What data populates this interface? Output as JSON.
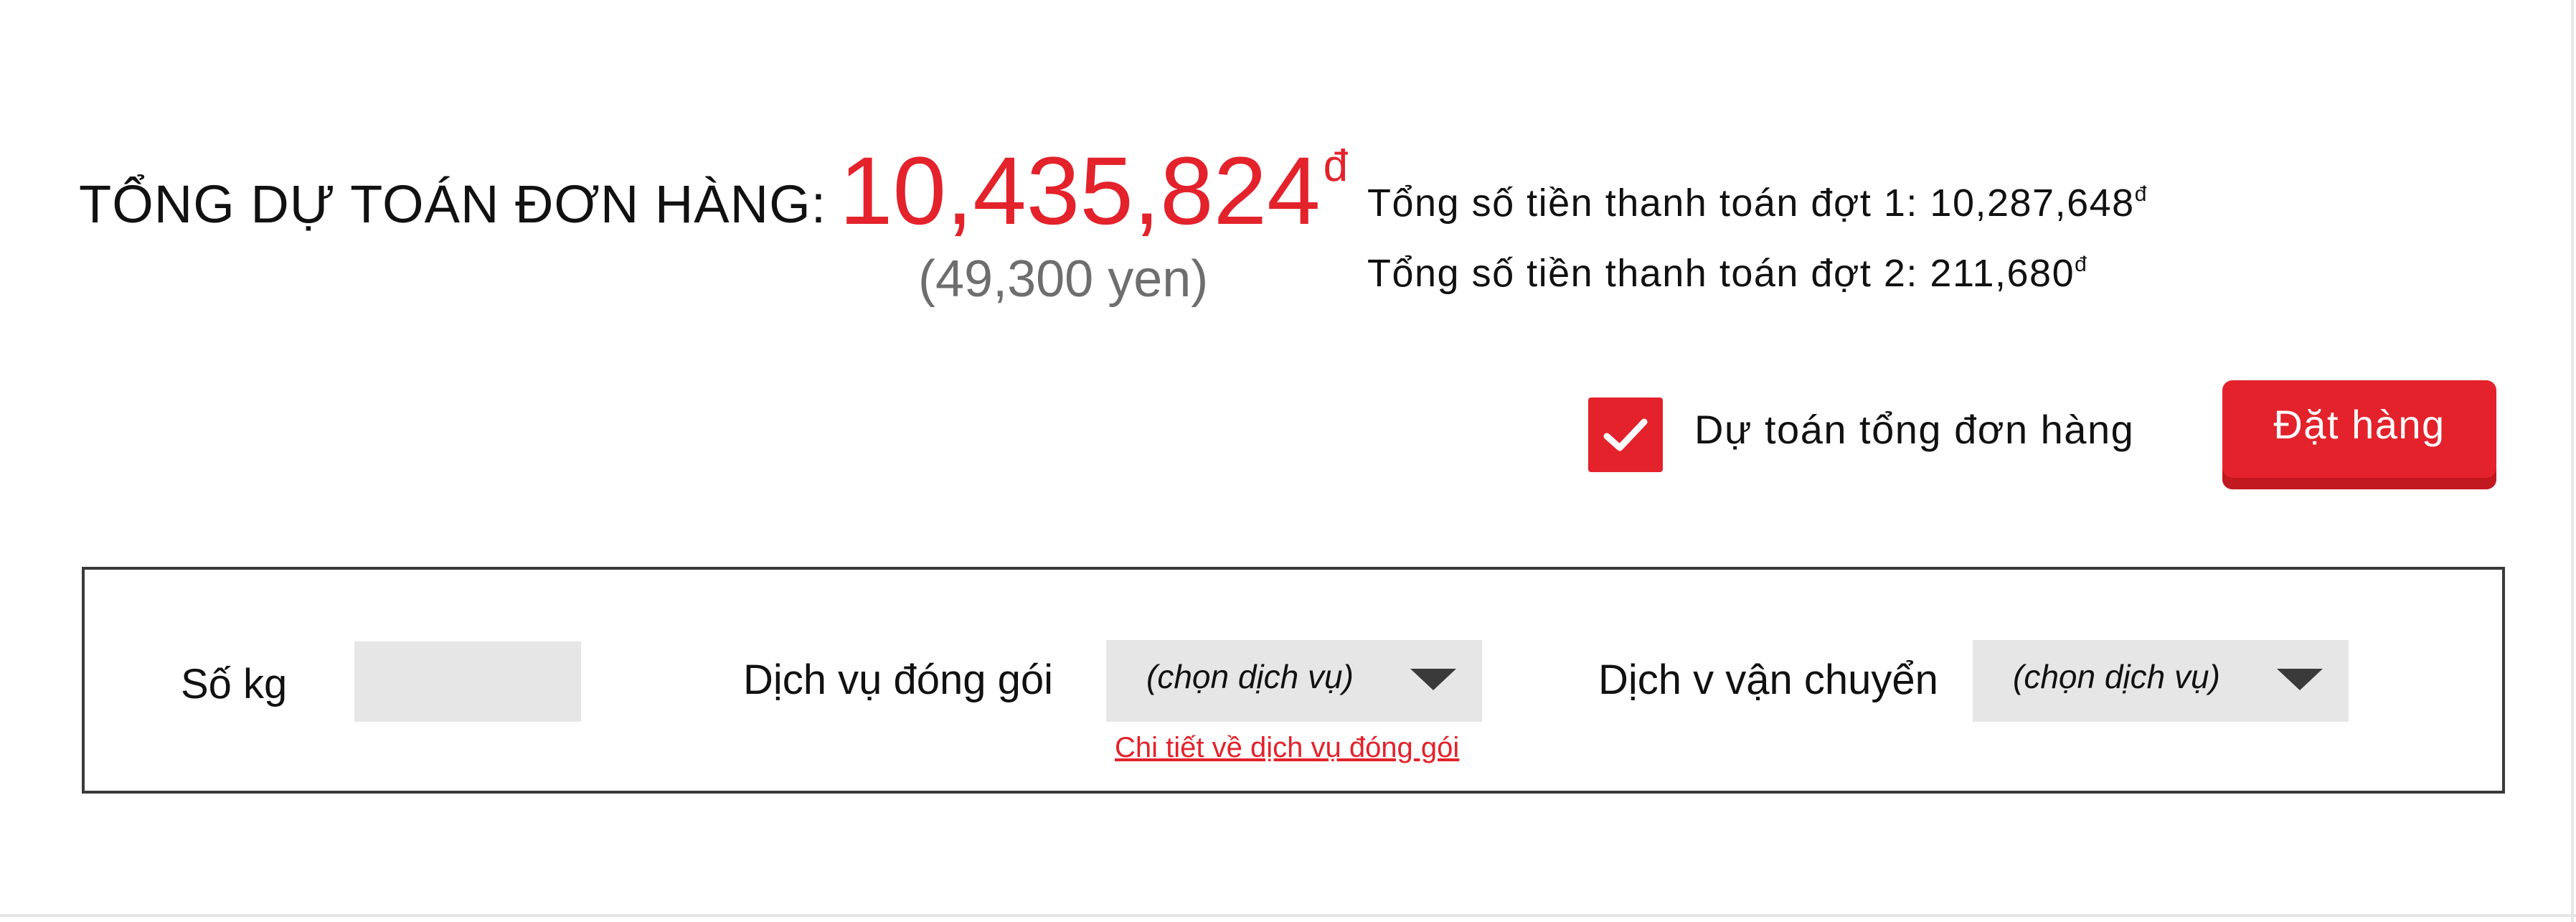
{
  "summary": {
    "title": "TỔNG DỰ TOÁN ĐƠN HÀNG:",
    "total_amount": "10,435,824",
    "total_currency": "đ",
    "yen_equivalent": "(49,300 yen)",
    "payment1_label": "Tổng số tiền thanh toán đợt 1: 10,287,648",
    "payment1_currency": "đ",
    "payment2_label": "Tổng số tiền thanh toán đợt 2: 211,680",
    "payment2_currency": "đ"
  },
  "actions": {
    "estimate_checkbox_label": "Dự toán tổng đơn hàng",
    "estimate_checked": true,
    "order_button_label": "Đặt hàng"
  },
  "options": {
    "kg_label": "Số kg",
    "kg_value": "",
    "packing_label": "Dịch vụ đóng gói",
    "packing_select_value": "(chọn dịch vụ)",
    "packing_detail_link": "Chi tiết về dịch vụ đóng gói",
    "shipping_label": "Dịch v vận chuyển",
    "shipping_select_value": "(chọn dịch vụ)"
  },
  "colors": {
    "accent": "#e3222b",
    "input_bg": "#e6e6e6",
    "border": "#3a3a3a"
  },
  "icons": {
    "checkbox": "checkmark-icon",
    "dropdown": "caret-down-icon"
  }
}
